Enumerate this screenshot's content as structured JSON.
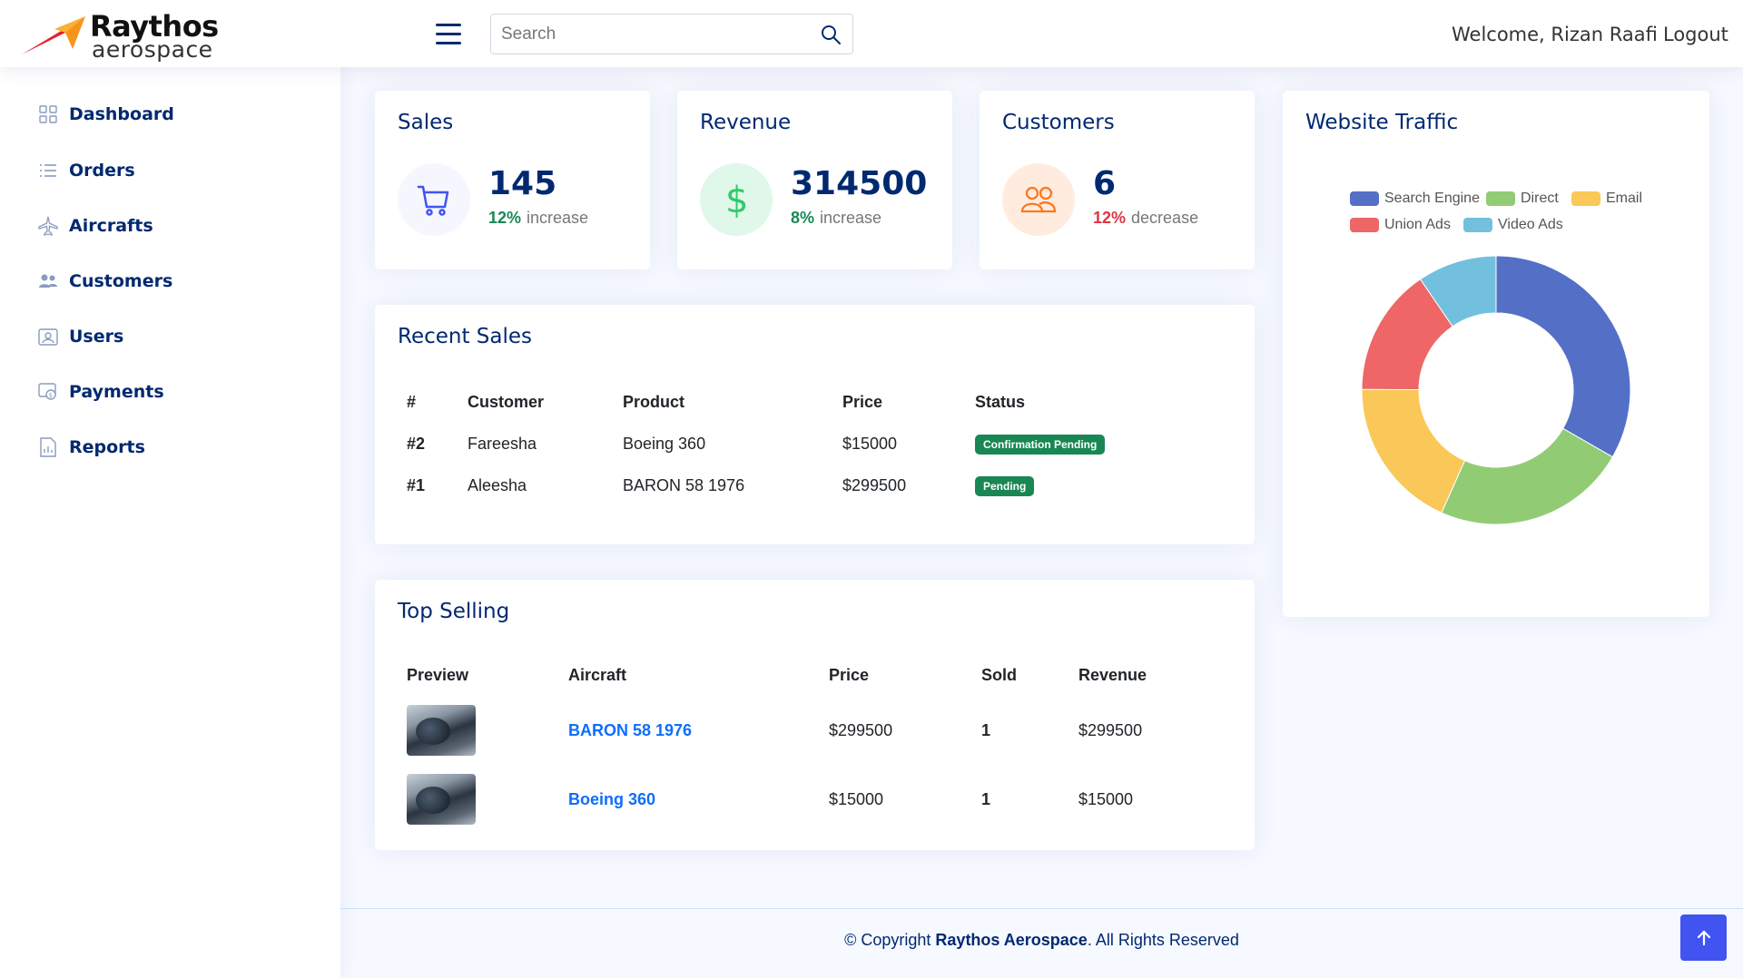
{
  "brand": {
    "title": "Raythos",
    "subtitle": "aerospace",
    "colors": {
      "orange": "#f7941d",
      "red": "#e8202a"
    }
  },
  "header": {
    "search_placeholder": "Search",
    "welcome": "Welcome, Rizan Raafi",
    "logout": "Logout"
  },
  "sidebar": {
    "items": [
      {
        "label": "Dashboard",
        "icon": "grid-icon"
      },
      {
        "label": "Orders",
        "icon": "list-icon"
      },
      {
        "label": "Aircrafts",
        "icon": "airplane-icon"
      },
      {
        "label": "Customers",
        "icon": "people-icon"
      },
      {
        "label": "Users",
        "icon": "user-badge-icon"
      },
      {
        "label": "Payments",
        "icon": "payment-icon"
      },
      {
        "label": "Reports",
        "icon": "report-icon"
      }
    ]
  },
  "stats": {
    "sales": {
      "title": "Sales",
      "value": "145",
      "pct": "12%",
      "word": "increase",
      "icon": "cart-icon"
    },
    "revenue": {
      "title": "Revenue",
      "value": "314500",
      "pct": "8%",
      "word": "increase",
      "icon": "dollar-icon"
    },
    "customers": {
      "title": "Customers",
      "value": "6",
      "pct": "12%",
      "word": "decrease",
      "icon": "people-icon"
    }
  },
  "recent_sales": {
    "title": "Recent Sales",
    "headers": [
      "#",
      "Customer",
      "Product",
      "Price",
      "Status"
    ],
    "rows": [
      {
        "id": "#2",
        "customer": "Fareesha",
        "product": "Boeing 360",
        "price": "$15000",
        "status": "Confirmation Pending"
      },
      {
        "id": "#1",
        "customer": "Aleesha",
        "product": "BARON 58 1976",
        "price": "$299500",
        "status": "Pending"
      }
    ]
  },
  "top_selling": {
    "title": "Top Selling",
    "headers": [
      "Preview",
      "Aircraft",
      "Price",
      "Sold",
      "Revenue"
    ],
    "rows": [
      {
        "aircraft": "BARON 58 1976",
        "price": "$299500",
        "sold": "1",
        "revenue": "$299500"
      },
      {
        "aircraft": "Boeing 360",
        "price": "$15000",
        "sold": "1",
        "revenue": "$15000"
      }
    ]
  },
  "traffic": {
    "title": "Website Traffic",
    "legend": [
      "Search Engine",
      "Direct",
      "Email",
      "Union Ads",
      "Video Ads"
    ]
  },
  "chart_data": {
    "type": "pie",
    "title": "Website Traffic",
    "categories": [
      "Search Engine",
      "Direct",
      "Email",
      "Union Ads",
      "Video Ads"
    ],
    "values": [
      1048,
      735,
      580,
      484,
      300
    ],
    "colors": [
      "#5470c6",
      "#91cc75",
      "#fac858",
      "#ee6666",
      "#73c0de"
    ],
    "legend": "top"
  },
  "footer": {
    "prefix": "© Copyright",
    "brand": "Raythos Aerospace",
    "suffix": ". All Rights Reserved"
  }
}
